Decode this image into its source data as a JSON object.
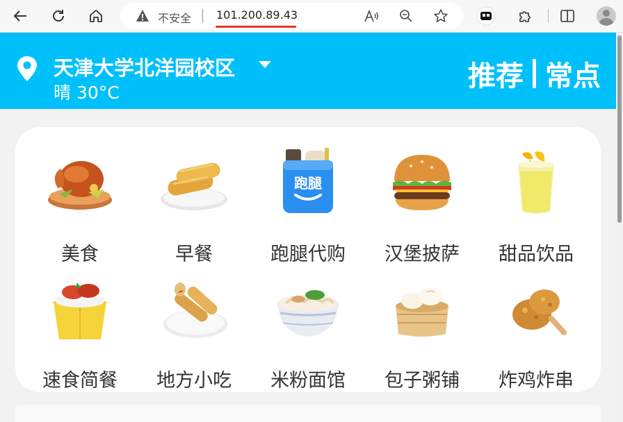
{
  "browser": {
    "insecure_label": "不安全",
    "url": "101.200.89.43"
  },
  "header": {
    "campus": "天津大学北洋园校区",
    "weather": "晴 30°C",
    "tab_recommend": "推荐",
    "tab_separator": "|",
    "tab_frequent": "常点"
  },
  "categories": [
    {
      "label": "美食",
      "icon": "roast-chicken-icon"
    },
    {
      "label": "早餐",
      "icon": "breakfast-icon"
    },
    {
      "label": "跑腿代购",
      "icon": "errand-bag-icon"
    },
    {
      "label": "汉堡披萨",
      "icon": "burger-icon"
    },
    {
      "label": "甜品饮品",
      "icon": "drink-icon"
    },
    {
      "label": "速食简餐",
      "icon": "fast-food-box-icon"
    },
    {
      "label": "地方小吃",
      "icon": "snack-roll-icon"
    },
    {
      "label": "米粉面馆",
      "icon": "noodle-bowl-icon"
    },
    {
      "label": "包子粥铺",
      "icon": "steamed-bun-icon"
    },
    {
      "label": "炸鸡炸串",
      "icon": "fried-chicken-icon"
    }
  ],
  "colors": {
    "header_bg": "#00c0fb",
    "url_underline": "#e8332a"
  },
  "errand_logo_text": "跑腿"
}
